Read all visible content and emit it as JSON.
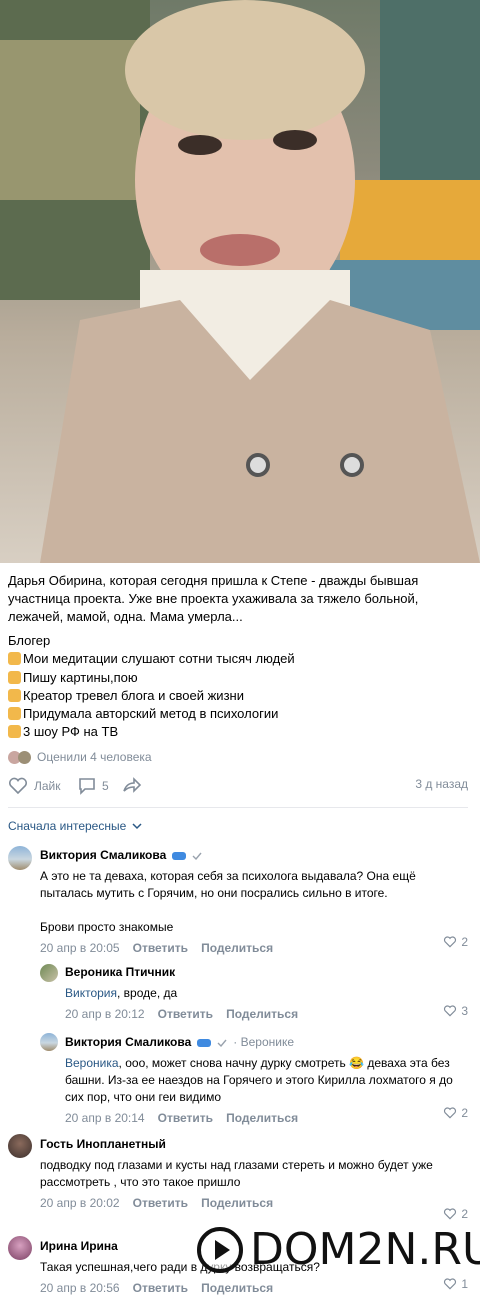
{
  "post": {
    "text": "Дарья Обирина, которая сегодня пришла к Степе - дважды бывшая участница проекта. Уже вне проекта ухаживала за тяжело больной, лежачей, мамой, одна. Мама умерла...",
    "bio_title": "Блогер",
    "bio_lines": [
      "Мои медитации слушают сотни тысяч людей",
      "Пишу картины,пою",
      "Креатор тревел блога и своей жизни",
      "Придумала авторский метод в психологии",
      "3 шоу РФ на ТВ"
    ],
    "rated": "Оценили 4 человека",
    "like_label": "Лайк",
    "comments_count": "5",
    "time": "3 д назад"
  },
  "sort_label": "Сначала интересные",
  "comments": [
    {
      "author": "Виктория Смаликова",
      "text1": "А это не та деваха, которая себя за психолога выдавала? Она ещё пыталась мутить с Горячим, но они посрались сильно в итоге.",
      "text2": "Брови просто знакомые",
      "date": "20 апр в 20:05",
      "reply": "Ответить",
      "share": "Поделиться",
      "likes": "2"
    },
    {
      "author": "Вероника Птичник",
      "mention": "Виктория",
      "text": ", вроде, да",
      "date": "20 апр в 20:12",
      "reply": "Ответить",
      "share": "Поделиться",
      "likes": "3"
    },
    {
      "author": "Виктория Смаликова",
      "reply_to": "Веронике",
      "mention": "Вероника",
      "text": ", ооо, может снова начну дурку смотреть 😂 деваха эта без башни. Из-за ее наездов на Горячего и этого Кирилла лохматого я до сих пор, что они геи видимо",
      "date": "20 апр в 20:14",
      "reply": "Ответить",
      "share": "Поделиться",
      "likes": "2"
    },
    {
      "author": "Гость Инопланетный",
      "text": "подводку под глазами и кусты над глазами стереть и можно будет уже рассмотреть , что это такое пришло",
      "date": "20 апр в 20:02",
      "reply": "Ответить",
      "share": "Поделиться",
      "likes": "2"
    },
    {
      "author": "Ирина Ирина",
      "text": "Такая успешная,чего ради в дурку возвращаться?",
      "date": "20 апр в 20:56",
      "reply": "Ответить",
      "share": "Поделиться",
      "likes": "1"
    }
  ],
  "watermark": "DOM2N.RU",
  "colors": {
    "link": "#2a5885",
    "meta": "#818c99",
    "accent": "#3f8ae0"
  }
}
